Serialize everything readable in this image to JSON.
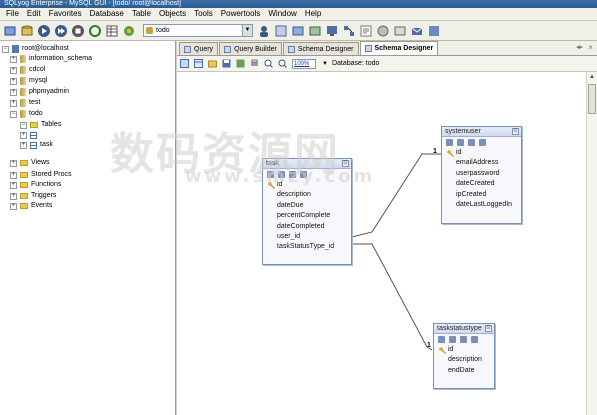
{
  "window": {
    "title": "SQLyog Enterprise - MySQL GUI - [todo/ root@localhost]"
  },
  "menu": [
    "File",
    "Edit",
    "Favorites",
    "Database",
    "Table",
    "Objects",
    "Tools",
    "Powertools",
    "Window",
    "Help"
  ],
  "toolbar": {
    "database_select": "todo"
  },
  "tree": {
    "root": "root@localhost",
    "databases": [
      "information_schema",
      "cdcol",
      "mysql",
      "phpmyadmin",
      "test",
      "todo"
    ],
    "tables_folder": "Tables",
    "tables": [
      "",
      "task"
    ],
    "folders": [
      "Views",
      "Stored Procs",
      "Functions",
      "Triggers",
      "Events"
    ]
  },
  "tabs": [
    "Query",
    "Query Builder",
    "Schema Designer",
    "Schema Designer"
  ],
  "designer": {
    "zoom": "100%",
    "database_label": "Database: todo"
  },
  "entities": {
    "task": {
      "name": "task",
      "pk": "id",
      "fields": [
        "description",
        "dateDue",
        "percentComplete",
        "dateCompleted",
        "user_id",
        "taskStatusType_id"
      ]
    },
    "systemuser": {
      "name": "systemuser",
      "pk": "id",
      "fields": [
        "emailAddress",
        "userpassword",
        "dateCreated",
        "ipCreated",
        "dateLastLoggedIn"
      ]
    },
    "taskstatustype": {
      "name": "taskstatustype",
      "pk": "id",
      "fields": [
        "description",
        "endDate"
      ]
    }
  },
  "relations": {
    "one_label": "1",
    "many_label": "∞"
  },
  "watermark": {
    "main": "数码资源网",
    "sub": "www.smzy.com"
  }
}
